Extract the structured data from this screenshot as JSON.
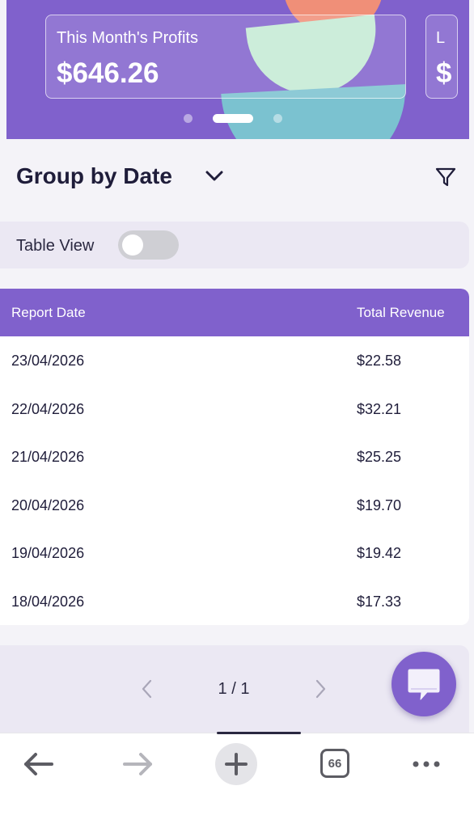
{
  "hero": {
    "cards": [
      {
        "title": "This Month's Profits",
        "value": "$646.26"
      },
      {
        "title": "L",
        "value": "$"
      }
    ],
    "pagination": {
      "dots": 3,
      "active_index": 1
    }
  },
  "group": {
    "title": "Group by Date",
    "dropdown_icon": "chevron-down-icon",
    "filter_icon": "filter-icon"
  },
  "table_view": {
    "label": "Table View",
    "enabled": false
  },
  "report_table": {
    "columns": [
      "Report Date",
      "Total Revenue"
    ],
    "rows": [
      {
        "date": "23/04/2026",
        "revenue": "$22.58"
      },
      {
        "date": "22/04/2026",
        "revenue": "$32.21"
      },
      {
        "date": "21/04/2026",
        "revenue": "$25.25"
      },
      {
        "date": "20/04/2026",
        "revenue": "$19.70"
      },
      {
        "date": "19/04/2026",
        "revenue": "$19.42"
      },
      {
        "date": "18/04/2026",
        "revenue": "$17.33"
      }
    ]
  },
  "pager": {
    "text": "1 / 1"
  },
  "chat_button": {
    "icon": "chat-bubble-icon"
  },
  "browser_bar": {
    "back_icon": "arrow-left-icon",
    "forward_icon": "arrow-right-icon",
    "new_tab_icon": "plus-icon",
    "tab_count": "66",
    "more_icon": "more-dots-icon"
  },
  "colors": {
    "accent": "#8061cc",
    "background": "#f4f3f8",
    "text": "#1f1d3a"
  }
}
